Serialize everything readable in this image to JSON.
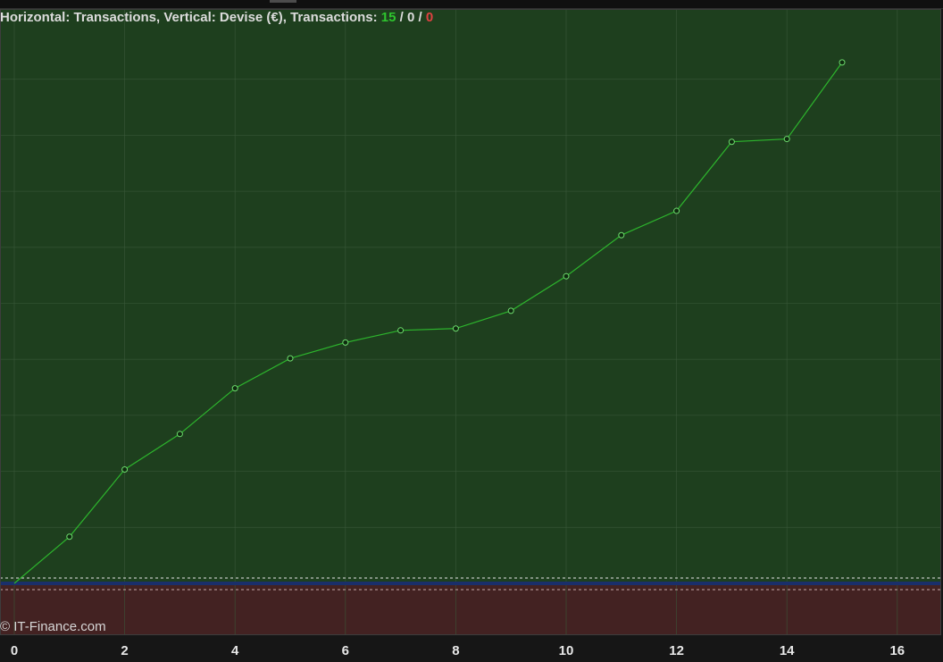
{
  "header": {
    "title_prefix": "Horizontal: Transactions, Vertical: Devise (€), Transactions: ",
    "wins": "15",
    "sep1": " / ",
    "neutral": "0",
    "sep2": " / ",
    "losses": "0"
  },
  "watermark": "© IT-Finance.com",
  "colors": {
    "profit_zone": "#1e3f1e",
    "loss_zone": "#432222",
    "line": "#2db52d",
    "grid": "#3a5a3a",
    "baseline": "#1a2f6a",
    "background": "#161616"
  },
  "chart_data": {
    "type": "line",
    "title": "",
    "xlabel": "Transactions",
    "ylabel": "Devise (€)",
    "x_ticks": [
      0,
      2,
      4,
      6,
      8,
      10,
      12,
      14,
      16
    ],
    "xlim": [
      0,
      16.5
    ],
    "ylim": [
      -6,
      59
    ],
    "grid": true,
    "series": [
      {
        "x": [
          0,
          1,
          2,
          3,
          4,
          5,
          6,
          7,
          8,
          9,
          10,
          11,
          12,
          13,
          14,
          15
        ],
        "values": [
          0,
          5.0,
          12.2,
          16.0,
          20.9,
          24.1,
          25.8,
          27.1,
          27.3,
          29.2,
          32.9,
          37.3,
          39.9,
          47.3,
          47.6,
          55.8
        ]
      }
    ]
  }
}
